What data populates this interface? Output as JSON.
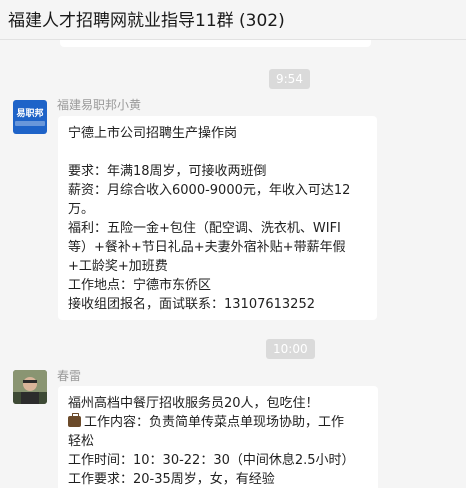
{
  "header": {
    "title": "福建人才招聘网就业指导11群 (302)"
  },
  "messages": [
    {
      "time": "9:54",
      "sender": "福建易职邦小黄",
      "avatar_label": "易职邦",
      "lines": [
        "宁德上市公司招聘生产操作岗",
        "",
        "要求：年满18周岁，可接收两班倒",
        "薪资：月综合收入6000-9000元，年收入可达12",
        "万。",
        "福利：五险一金+包住（配空调、洗衣机、WIFI",
        "等）+餐补+节日礼品+夫妻外宿补贴+带薪年假",
        "+工龄奖+加班费",
        "工作地点：宁德市东侨区",
        "接收组团报名，面试联系：13107613252"
      ]
    },
    {
      "time": "10:00",
      "sender": "春雷",
      "lines": [
        "福州高档中餐厅招收服务员20人，包吃住！",
        "工作内容：负责简单传菜点单现场协助，工作",
        "轻松",
        "工作时间：10：30-22：30（中间休息2.5小时）",
        "工作要求：20-35周岁，女，有经验"
      ],
      "icon": "briefcase-icon"
    }
  ],
  "colors": {
    "background": "#f5f5f5",
    "bubble": "#ffffff",
    "time_chip": "#dadada",
    "avatar_brand": "#1e63c8"
  }
}
